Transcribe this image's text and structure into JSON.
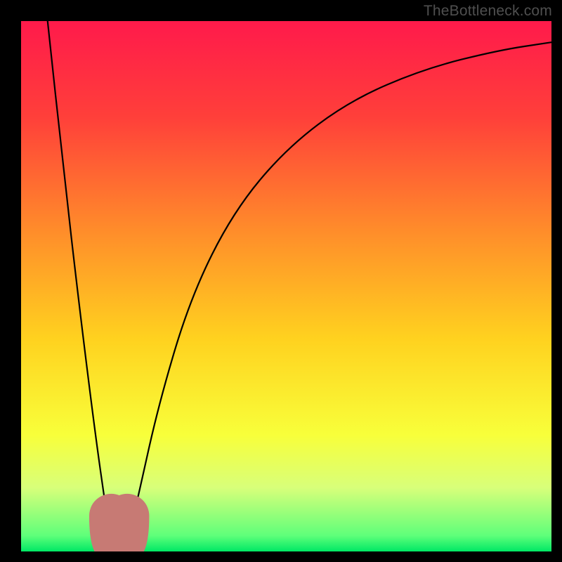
{
  "watermark": "TheBottleneck.com",
  "chart_data": {
    "type": "line",
    "title": "",
    "xlabel": "",
    "ylabel": "",
    "xlim": [
      0,
      100
    ],
    "ylim": [
      0,
      100
    ],
    "gradient_stops": [
      {
        "offset": 0.0,
        "color": "#ff1a4b"
      },
      {
        "offset": 0.18,
        "color": "#ff3f3a"
      },
      {
        "offset": 0.4,
        "color": "#ff8e2a"
      },
      {
        "offset": 0.6,
        "color": "#ffd21f"
      },
      {
        "offset": 0.78,
        "color": "#f8ff3a"
      },
      {
        "offset": 0.88,
        "color": "#d8ff7a"
      },
      {
        "offset": 0.97,
        "color": "#5fff7a"
      },
      {
        "offset": 1.0,
        "color": "#00e865"
      }
    ],
    "curve": {
      "note": "bottleneck-style V curve; y is percent mismatch, 0 at the bottom (optimal), 100 at top",
      "minimum_x": 18.5,
      "flat_segment_x": [
        17.0,
        20.0
      ],
      "points": [
        {
          "x": 5.0,
          "y": 100.0
        },
        {
          "x": 8.0,
          "y": 72.0
        },
        {
          "x": 11.0,
          "y": 46.0
        },
        {
          "x": 14.0,
          "y": 22.0
        },
        {
          "x": 16.0,
          "y": 8.0
        },
        {
          "x": 17.0,
          "y": 1.5
        },
        {
          "x": 18.5,
          "y": 1.0
        },
        {
          "x": 20.0,
          "y": 1.5
        },
        {
          "x": 22.0,
          "y": 10.0
        },
        {
          "x": 26.0,
          "y": 28.0
        },
        {
          "x": 32.0,
          "y": 48.0
        },
        {
          "x": 40.0,
          "y": 64.0
        },
        {
          "x": 50.0,
          "y": 76.0
        },
        {
          "x": 62.0,
          "y": 85.0
        },
        {
          "x": 76.0,
          "y": 91.0
        },
        {
          "x": 90.0,
          "y": 94.5
        },
        {
          "x": 100.0,
          "y": 96.0
        }
      ]
    },
    "markers": [
      {
        "x": 17.0,
        "y": 1.8,
        "r": 1.2,
        "color": "#c77a74"
      },
      {
        "x": 20.0,
        "y": 1.8,
        "r": 1.2,
        "color": "#c77a74"
      }
    ],
    "flat_bar": {
      "x0": 17.0,
      "x1": 20.0,
      "y": 1.0,
      "thickness": 2.6,
      "color": "#c77a74"
    }
  }
}
